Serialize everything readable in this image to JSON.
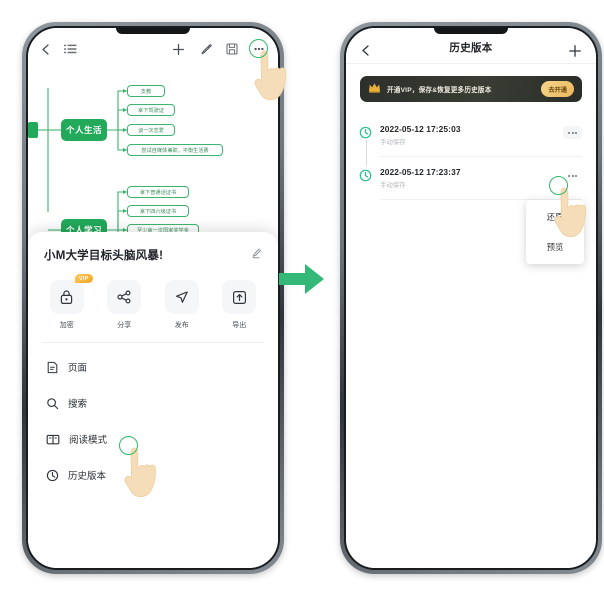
{
  "colors": {
    "brand_green": "#22a95a",
    "arrow_green": "#34b877",
    "vip_gold": "#e9b75d",
    "banner_dark": "#2c2f2b",
    "tap_ring": "#2fb866"
  },
  "left_phone": {
    "toolbar": {
      "back_icon": "chevron-left-icon",
      "outline_icon": "outline-list-icon",
      "add_icon": "plus-icon",
      "brush_icon": "brush-icon",
      "save_icon": "save-floppy-icon",
      "more_icon": "more-dots-icon"
    },
    "mindmap": {
      "branches": [
        {
          "root": "个人生活",
          "children": [
            "支教",
            "拿下驾驶证",
            "谈一次恋爱",
            "尝试自媒体兼职，平衡生活费"
          ]
        },
        {
          "root": "个人学习",
          "children": [
            "拿下普通话证书",
            "拿下四六级证书",
            "至少拿一次国家奖学金",
            ""
          ]
        }
      ]
    },
    "sheet": {
      "title": "小M大学目标头脑风暴!",
      "edit_icon": "pencil-icon",
      "actions": [
        {
          "icon": "lock-icon",
          "label": "加密",
          "badge": "VIP"
        },
        {
          "icon": "share-icon",
          "label": "分享",
          "badge": ""
        },
        {
          "icon": "send-icon",
          "label": "发布",
          "badge": ""
        },
        {
          "icon": "export-icon",
          "label": "导出",
          "badge": ""
        }
      ],
      "menu": [
        {
          "icon": "page-icon",
          "label": "页面"
        },
        {
          "icon": "search-icon",
          "label": "搜索"
        },
        {
          "icon": "book-icon",
          "label": "阅读模式"
        },
        {
          "icon": "clock-icon",
          "label": "历史版本"
        }
      ]
    }
  },
  "right_phone": {
    "appbar": {
      "back_icon": "chevron-left-icon",
      "title": "历史版本",
      "add_icon": "plus-icon"
    },
    "vip_banner": {
      "crown_icon": "crown-icon",
      "text": "开通VIP，保存&恢复更多历史版本",
      "cta": "去开通"
    },
    "versions": [
      {
        "time": "2022-05-12 17:25:03",
        "type": "手动保存",
        "more_icon": "more-dots-icon"
      },
      {
        "time": "2022-05-12 17:23:37",
        "type": "手动保存",
        "more_icon": "more-dots-icon"
      }
    ],
    "popup_menu": [
      {
        "label": "还原"
      },
      {
        "label": "预览"
      }
    ]
  },
  "flow": {
    "arrow_icon": "arrow-right-icon"
  }
}
